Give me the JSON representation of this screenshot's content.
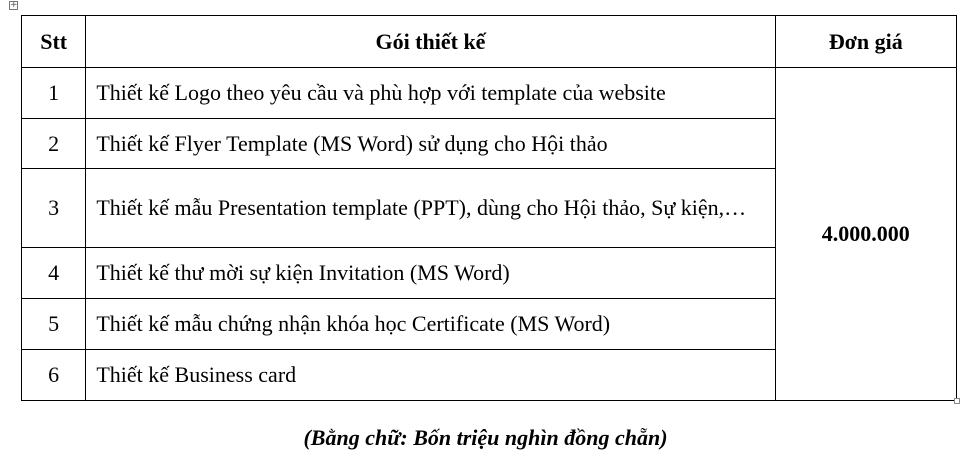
{
  "table": {
    "headers": {
      "stt": "Stt",
      "package": "Gói thiết kế",
      "price": "Đơn giá"
    },
    "rows": [
      {
        "stt": "1",
        "package": "Thiết kế Logo theo yêu cầu và phù hợp với template của website"
      },
      {
        "stt": "2",
        "package": "Thiết kế Flyer Template (MS Word) sử dụng cho Hội thảo"
      },
      {
        "stt": "3",
        "package": "Thiết kế mẫu Presentation template (PPT), dùng cho Hội thảo, Sự kiện,…"
      },
      {
        "stt": "4",
        "package": "Thiết kế thư mời sự kiện Invitation (MS Word)"
      },
      {
        "stt": "5",
        "package": "Thiết kế mẫu chứng nhận khóa học Certificate (MS Word)"
      },
      {
        "stt": "6",
        "package": "Thiết kế Business card"
      }
    ],
    "price_value": "4.000.000"
  },
  "note": "(Bằng chữ: Bốn triệu nghìn đồng chẵn)"
}
